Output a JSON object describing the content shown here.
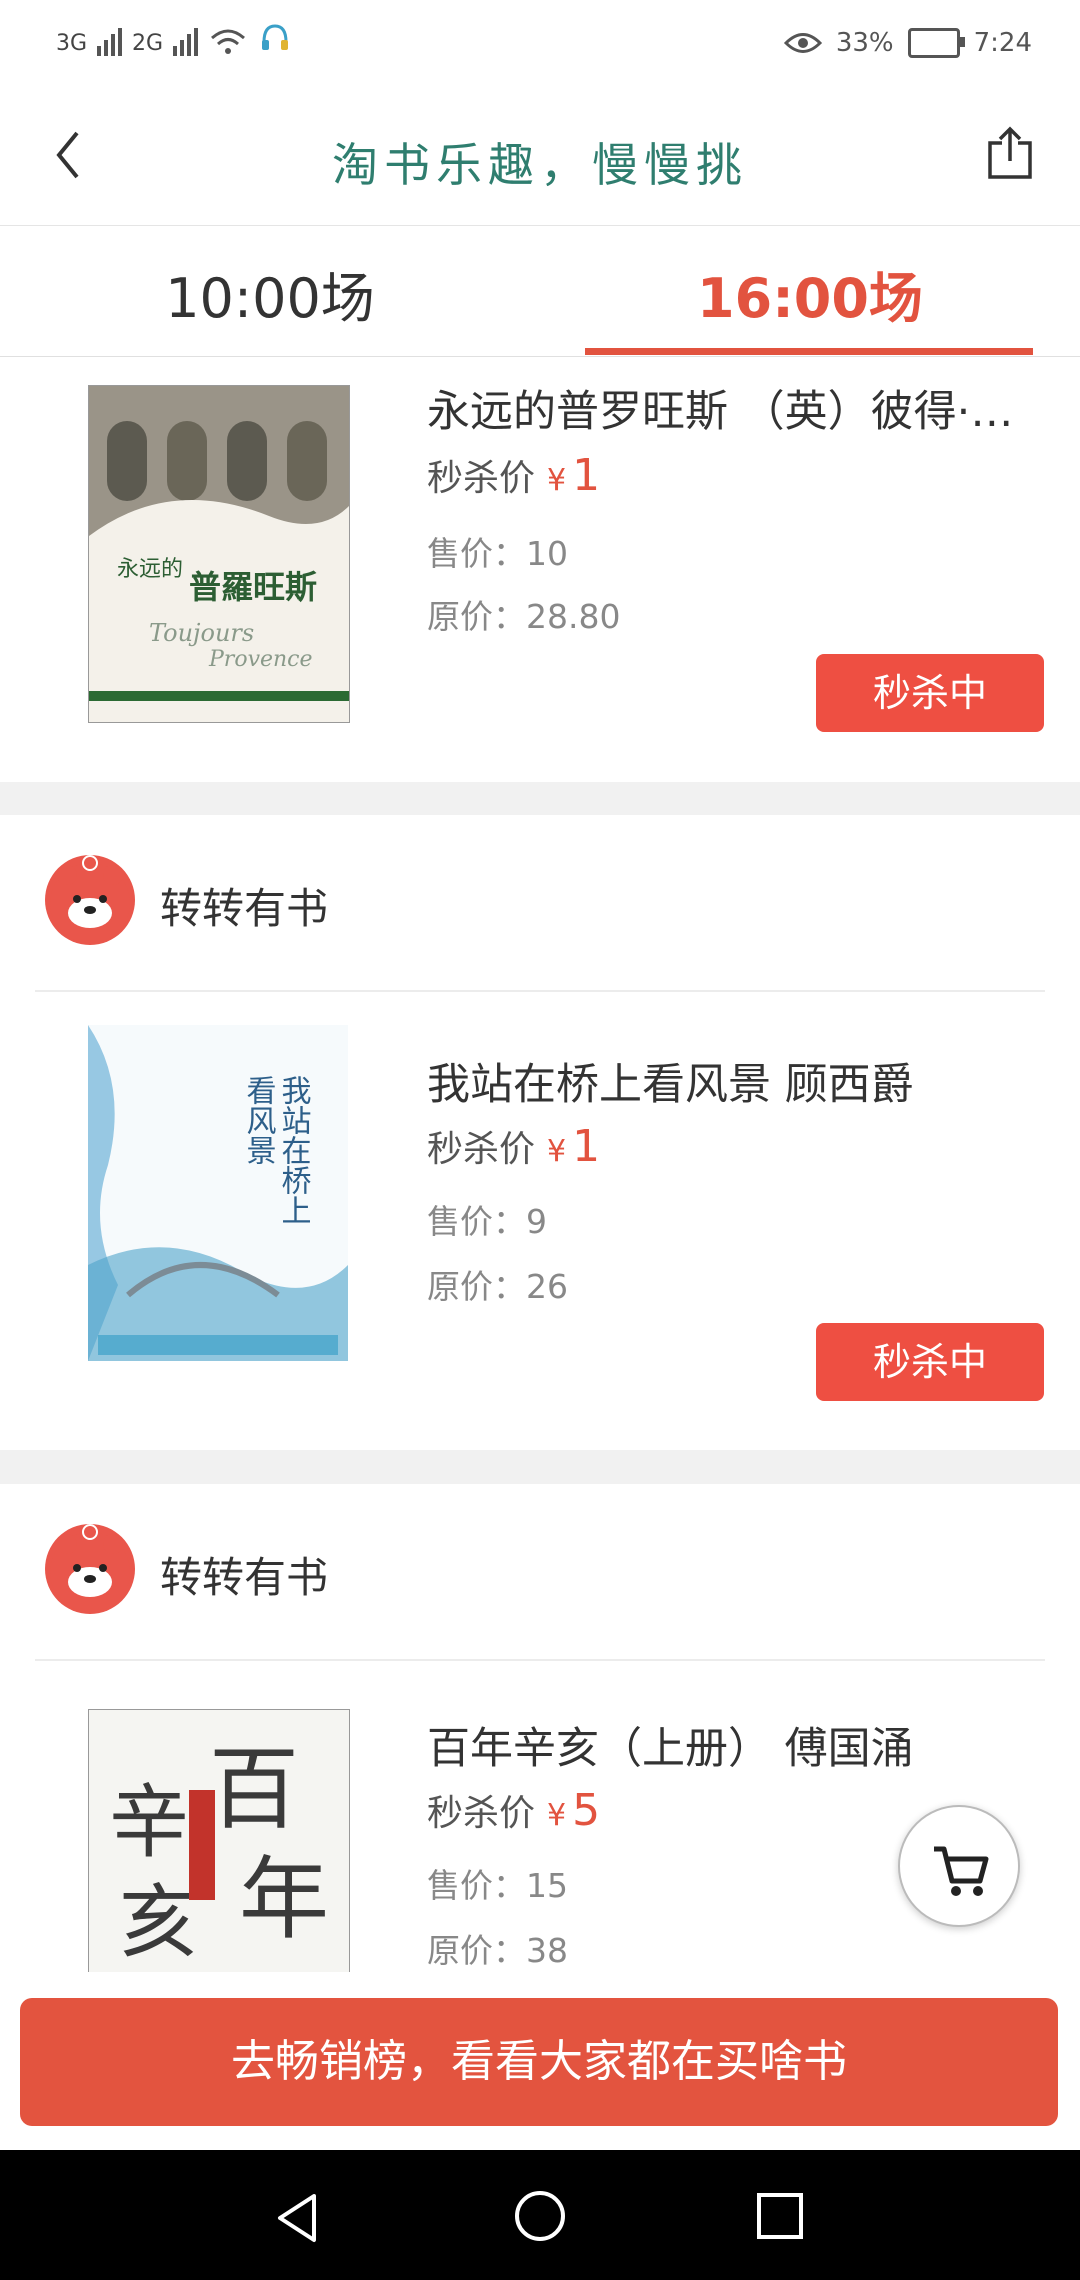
{
  "status_bar": {
    "net1": "3G",
    "net2": "2G",
    "battery": "33%",
    "time": "7:24"
  },
  "header": {
    "title": "淘书乐趣，慢慢挑"
  },
  "tabs": [
    {
      "label": "10:00场",
      "active": false
    },
    {
      "label": "16:00场",
      "active": true
    }
  ],
  "items": [
    {
      "shop": "",
      "title": "永远的普罗旺斯 （英）彼得·…",
      "flash_label": "秒杀价",
      "currency": "¥",
      "flash_price": "1",
      "sale": "售价：10",
      "original": "原价：28.80",
      "button": "秒杀中",
      "cover_text": "永远的普羅旺斯"
    },
    {
      "shop": "转转有书",
      "title": "我站在桥上看风景 顾西爵",
      "flash_label": "秒杀价",
      "currency": "¥",
      "flash_price": "1",
      "sale": "售价：9",
      "original": "原价：26",
      "button": "秒杀中",
      "cover_text": "我站在桥上看风景"
    },
    {
      "shop": "转转有书",
      "title": "百年辛亥（上册） 傅国涌",
      "flash_label": "秒杀价",
      "currency": "¥",
      "flash_price": "5",
      "sale": "售价：15",
      "original": "原价：38",
      "cover_text": "百年辛亥"
    }
  ],
  "banner": "去畅销榜，看看大家都在买啥书",
  "colors": {
    "accent": "#e2533f",
    "title_green": "#2f7e6f"
  },
  "icons": [
    "back-icon",
    "share-icon",
    "bear-logo-icon",
    "cart-icon",
    "nav-back-icon",
    "nav-home-icon",
    "nav-recents-icon"
  ]
}
